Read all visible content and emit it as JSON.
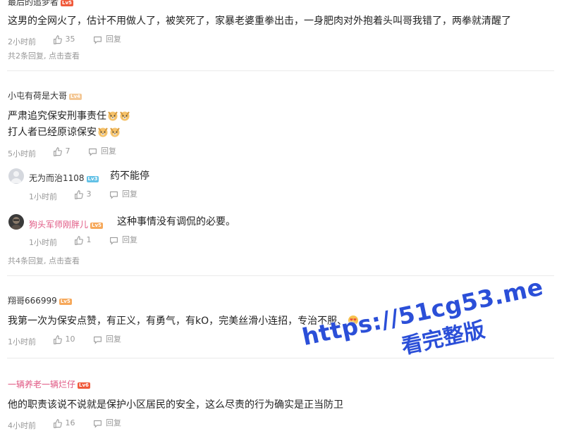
{
  "comments": [
    {
      "username": "最后的追梦者",
      "level": "Lv5",
      "text": "这男的全网火了，估计不用做人了，被笑死了，家暴老婆重拳出击，一身肥肉对外抱着头叫哥我错了，两拳就清醒了",
      "time": "2小时前",
      "likes": "35",
      "reply_label": "回复",
      "more_replies": "共2条回复, 点击查看"
    },
    {
      "username": "小屯有荷是大哥",
      "level": "Lv4",
      "text_line1": "严肃追究保安刑事责任",
      "text_line2": "打人者已经原谅保安",
      "emoji_name": "dog-face-emoji",
      "time": "5小时前",
      "likes": "7",
      "reply_label": "回复",
      "replies": [
        {
          "username": "无为而治1108",
          "level": "Lv3",
          "text": "药不能停",
          "time": "1小时前",
          "likes": "3",
          "reply_label": "回复"
        },
        {
          "username": "狗头军师刚胖儿",
          "level": "Lv5",
          "text": "这种事情没有调侃的必要。",
          "time": "1小时前",
          "likes": "1",
          "reply_label": "回复"
        }
      ],
      "more_replies": "共4条回复, 点击查看"
    },
    {
      "username": "翔哥666999",
      "level": "Lv5",
      "text": "我第一次为保安点赞，有正义，有勇气，有kO，完美丝滑小连招，专治不服、",
      "emoji_name": "heart-eyes-emoji",
      "time": "1小时前",
      "likes": "10",
      "reply_label": "回复"
    },
    {
      "username": "一辆养老一辆烂仔",
      "level": "Lv6",
      "text": "他的职责该说不说就是保护小区居民的安全，这么尽责的行为确实是正当防卫",
      "time": "4小时前",
      "likes": "16",
      "reply_label": "回复"
    }
  ],
  "watermark": {
    "line1": "https://51cg53.me",
    "line2": "看完整版",
    "color": "#2b4fd8"
  },
  "colors": {
    "username_pink": "#e05783",
    "meta_grey": "#999999",
    "divider": "#eaeaea"
  },
  "icons": {
    "like": "thumbs-up-icon",
    "reply": "speech-bubble-icon"
  }
}
